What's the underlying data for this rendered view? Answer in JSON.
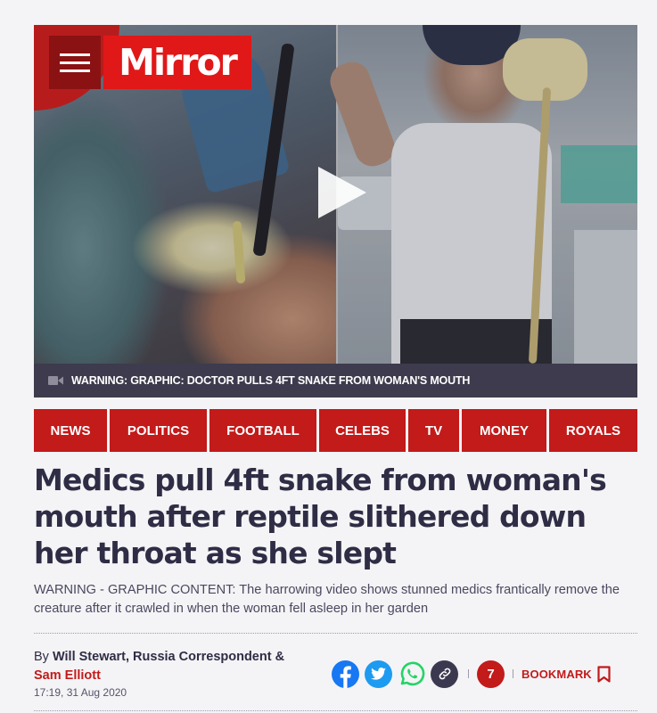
{
  "brand": {
    "logo_text": "Mirror",
    "accent": "#c31a1a",
    "logo_red": "#e01818"
  },
  "video": {
    "caption": "WARNING: GRAPHIC: DOCTOR PULLS 4FT SNAKE FROM WOMAN'S MOUTH",
    "caption_icon": "video-camera-icon",
    "play_icon": "play-icon"
  },
  "nav": {
    "items": [
      {
        "label": "NEWS"
      },
      {
        "label": "POLITICS"
      },
      {
        "label": "FOOTBALL"
      },
      {
        "label": "CELEBS"
      },
      {
        "label": "TV"
      },
      {
        "label": "MONEY"
      },
      {
        "label": "ROYALS"
      }
    ]
  },
  "article": {
    "headline": "Medics pull 4ft snake from woman's mouth after reptile slithered down her throat as she slept",
    "standfirst": "WARNING - GRAPHIC CONTENT: The harrowing video shows stunned medics frantically remove the creature after it crawled in when the woman fell asleep in her garden",
    "byline": {
      "prefix": "By",
      "author1": "Will Stewart, Russia Correspondent",
      "joiner": "&",
      "author2": "Sam Elliott"
    },
    "timestamp": "17:19, 31 Aug 2020"
  },
  "share": {
    "icons": [
      "facebook-icon",
      "twitter-icon",
      "whatsapp-icon",
      "link-icon"
    ],
    "comment_count": "7",
    "bookmark_label": "BOOKMARK"
  }
}
